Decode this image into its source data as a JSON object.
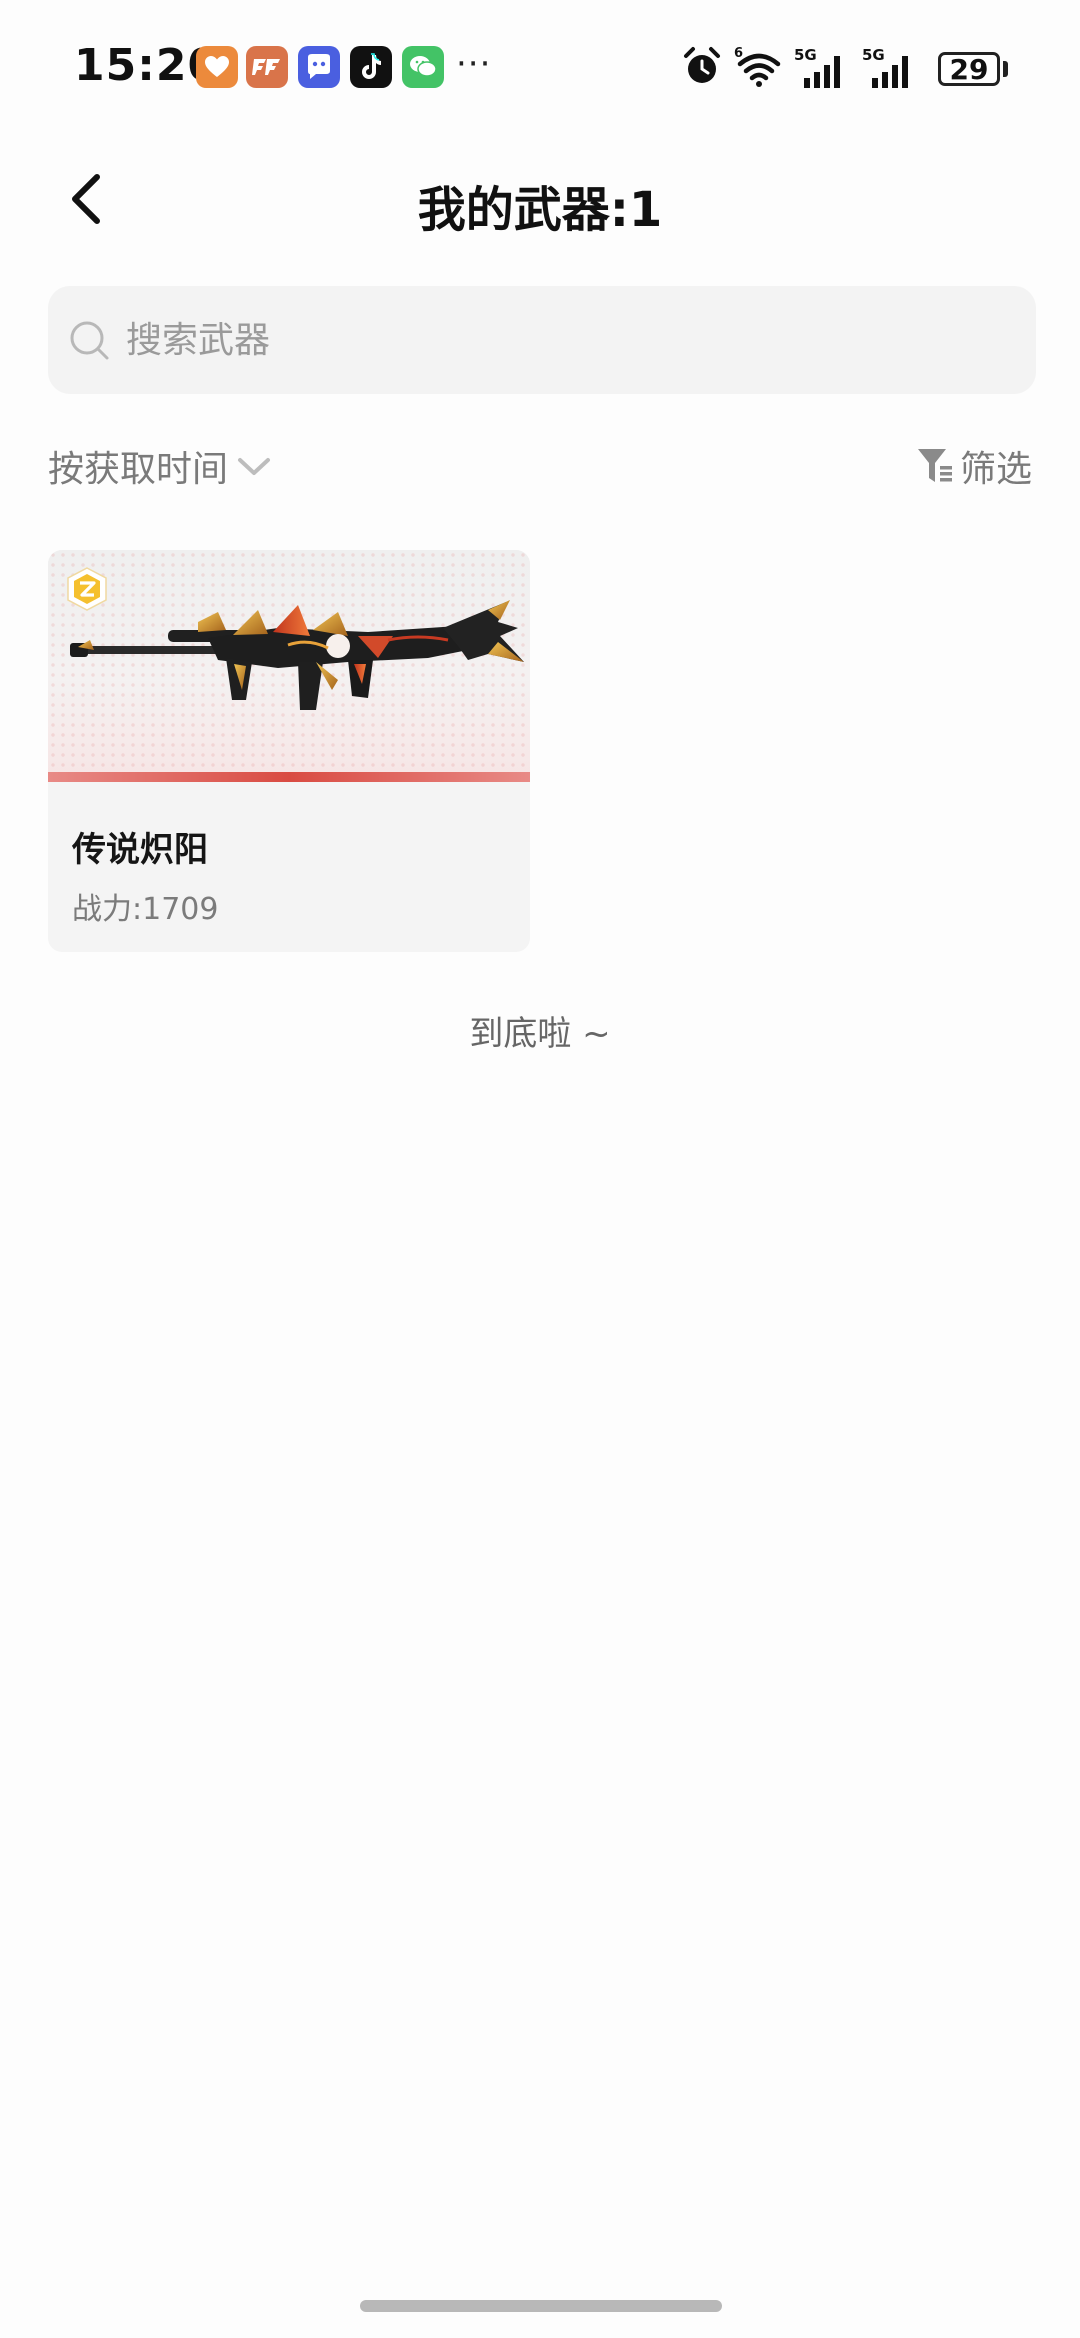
{
  "status_bar": {
    "time": "15:20",
    "more": "···",
    "battery": "29",
    "signal_1": "5G",
    "signal_2": "5G",
    "wifi_badge": "6",
    "notification_apps": [
      "health-app-icon",
      "game-app-icon",
      "chat-bot-app-icon",
      "tiktok-app-icon",
      "wechat-app-icon"
    ],
    "colors": {
      "health": "#ec8a3c",
      "game": "#d9744a",
      "chatbot": "#4a5fe0",
      "tiktok": "#111111",
      "wechat": "#43c366"
    }
  },
  "header": {
    "title": "我的武器:1",
    "back_icon": "chevron-left-icon"
  },
  "search": {
    "placeholder": "搜索武器",
    "icon": "search-icon"
  },
  "sort": {
    "label": "按获取时间",
    "icon": "chevron-down-icon"
  },
  "filter": {
    "label": "筛选",
    "icon": "filter-icon"
  },
  "weapons": [
    {
      "name": "传说炽阳",
      "power": "战力:1709",
      "rarity_color": "#d94b42"
    }
  ],
  "list_end": "到底啦 ~",
  "colors": {
    "background": "#fdfdfd",
    "card": "#f4f4f4",
    "search_bg": "#f3f3f3",
    "muted_text": "#7a7a7a"
  }
}
